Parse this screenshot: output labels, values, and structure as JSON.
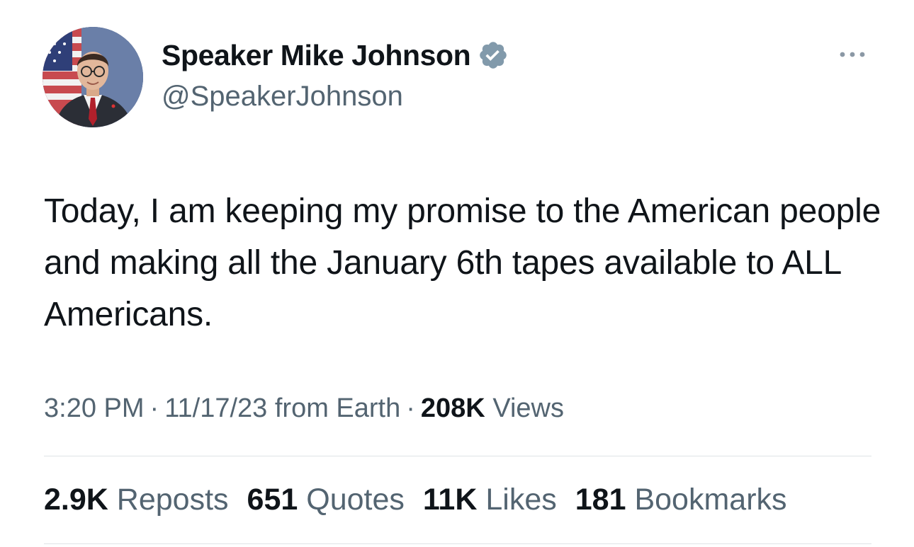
{
  "author": {
    "display_name": "Speaker Mike Johnson",
    "handle": "@SpeakerJohnson",
    "verified_badge_color": "#829aab"
  },
  "tweet": {
    "text": "Today, I am keeping my promise to the American people and making all the January 6th tapes available to ALL Americans.",
    "time": "3:20 PM",
    "date": "11/17/23",
    "source": "from Earth",
    "separator": "·",
    "views_count": "208K",
    "views_label": "Views"
  },
  "stats": {
    "reposts_count": "2.9K",
    "reposts_label": "Reposts",
    "quotes_count": "651",
    "quotes_label": "Quotes",
    "likes_count": "11K",
    "likes_label": "Likes",
    "bookmarks_count": "181",
    "bookmarks_label": "Bookmarks"
  },
  "icons": {
    "verified": "verified-badge-icon",
    "more": "more-options-icon"
  },
  "colors": {
    "primary_text": "#0f1419",
    "secondary_text": "#536471",
    "divider": "#dfe3e6"
  }
}
